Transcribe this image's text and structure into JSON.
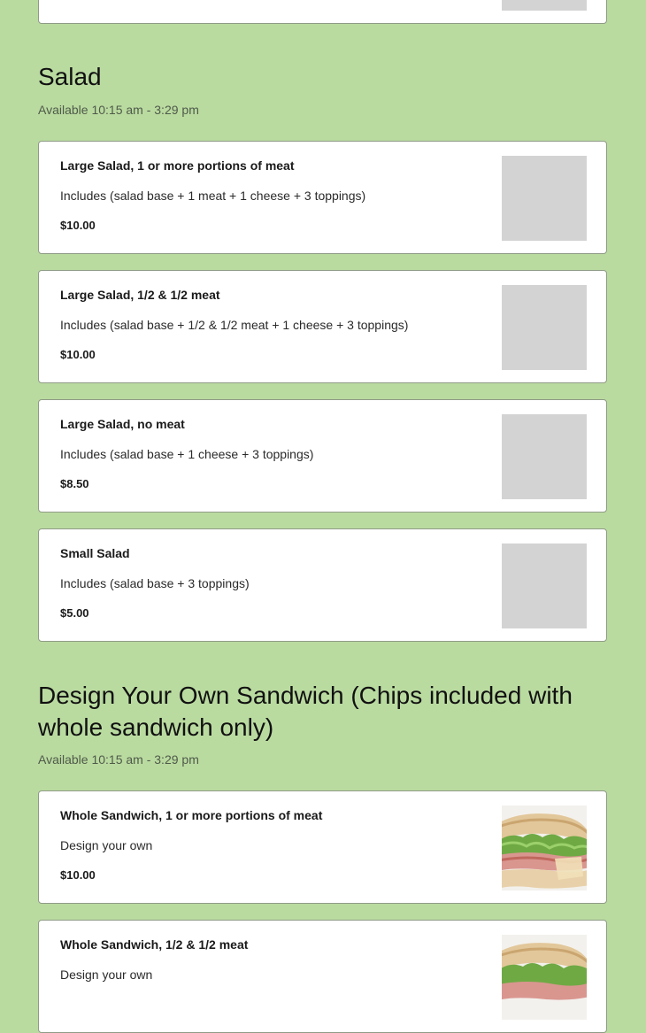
{
  "sections": [
    {
      "title": "Salad",
      "hours": "Available 10:15 am - 3:29 pm",
      "items": [
        {
          "name": "Large Salad, 1 or more portions of meat",
          "description": "Includes (salad base + 1 meat + 1 cheese + 3 toppings)",
          "price": "$10.00",
          "image": "placeholder"
        },
        {
          "name": "Large Salad, 1/2 & 1/2 meat",
          "description": "Includes (salad base + 1/2 & 1/2 meat + 1 cheese + 3 toppings)",
          "price": "$10.00",
          "image": "placeholder"
        },
        {
          "name": "Large Salad, no meat",
          "description": "Includes (salad base + 1 cheese + 3 toppings)",
          "price": "$8.50",
          "image": "placeholder"
        },
        {
          "name": "Small Salad",
          "description": "Includes (salad base + 3 toppings)",
          "price": "$5.00",
          "image": "placeholder"
        }
      ]
    },
    {
      "title": "Design Your Own Sandwich (Chips included with whole sandwich only)",
      "hours": "Available 10:15 am - 3:29 pm",
      "items": [
        {
          "name": "Whole Sandwich, 1 or more portions of meat",
          "description": "Design your own",
          "price": "$10.00",
          "image": "sandwich-photo"
        },
        {
          "name": "Whole Sandwich, 1/2 & 1/2 meat",
          "description": "Design your own",
          "price": "",
          "image": "sandwich-photo"
        }
      ]
    }
  ],
  "colors": {
    "page_background": "#badba0",
    "card_background": "#ffffff",
    "card_border": "#8f9b86",
    "image_placeholder": "#d3d3d3"
  }
}
